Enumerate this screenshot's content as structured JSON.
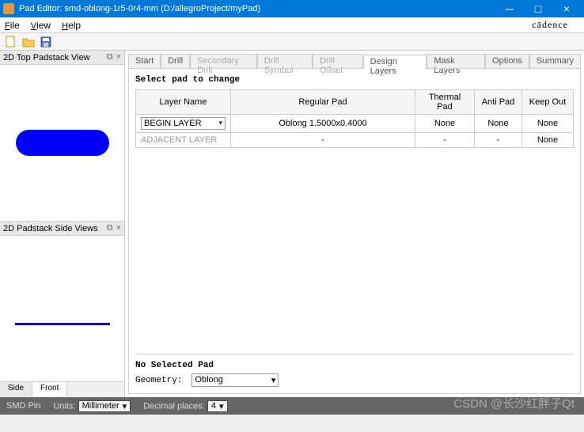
{
  "window": {
    "title": "Pad Editor: smd-oblong-1r5-0r4-mm  (D:/allegroProject/myPad)"
  },
  "menu": {
    "file": "File",
    "view": "View",
    "help": "Help",
    "brand": "cādence"
  },
  "panels": {
    "top_title": "2D Top Padstack View",
    "side_title": "2D Padstack Side Views",
    "side_tab1": "Side",
    "side_tab2": "Front"
  },
  "tabs": {
    "start": "Start",
    "drill": "Drill",
    "sec_drill": "Secondary Drill",
    "drill_sym": "Drill Symbol",
    "drill_off": "Drill Offset",
    "design": "Design Layers",
    "mask": "Mask Layers",
    "options": "Options",
    "summary": "Summary"
  },
  "content": {
    "select_pad": "Select pad to change",
    "headers": {
      "layer": "Layer Name",
      "regular": "Regular Pad",
      "thermal": "Thermal Pad",
      "anti": "Anti Pad",
      "keep": "Keep Out"
    },
    "rows": [
      {
        "layer": "BEGIN LAYER",
        "regular": "Oblong 1.5000x0.4000",
        "thermal": "None",
        "anti": "None",
        "keep": "None"
      },
      {
        "layer": "ADJACENT LAYER",
        "regular": "-",
        "thermal": "-",
        "anti": "-",
        "keep": "None"
      }
    ],
    "no_sel": "No Selected Pad",
    "geometry_label": "Geometry:",
    "geometry_value": "Oblong"
  },
  "status": {
    "smd": "SMD Pin",
    "units_label": "Units:",
    "units_value": "Millimeter",
    "decimal_label": "Decimal places:",
    "decimal_value": "4"
  },
  "watermark": "CSDN @长沙红胖子Qt"
}
